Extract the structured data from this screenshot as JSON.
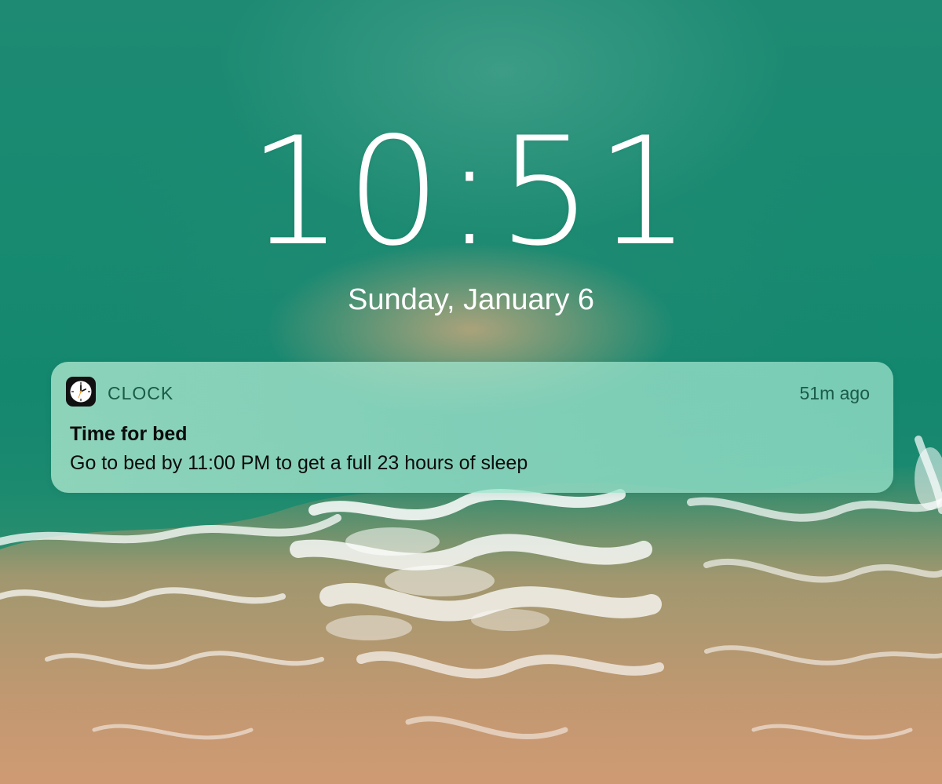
{
  "lock_screen": {
    "time": "10:51",
    "date": "Sunday, January 6"
  },
  "notification": {
    "app_icon": "clock-icon",
    "app_name": "CLOCK",
    "timestamp": "51m ago",
    "title": "Time for bed",
    "body": "Go to bed by 11:00 PM to get a full 23 hours of sleep"
  },
  "colors": {
    "sea": "#178a70",
    "sand": "#c99a72",
    "foam": "#ffffff",
    "notification_tint": "#a8e4cd",
    "app_name_text": "#1a5b48"
  }
}
